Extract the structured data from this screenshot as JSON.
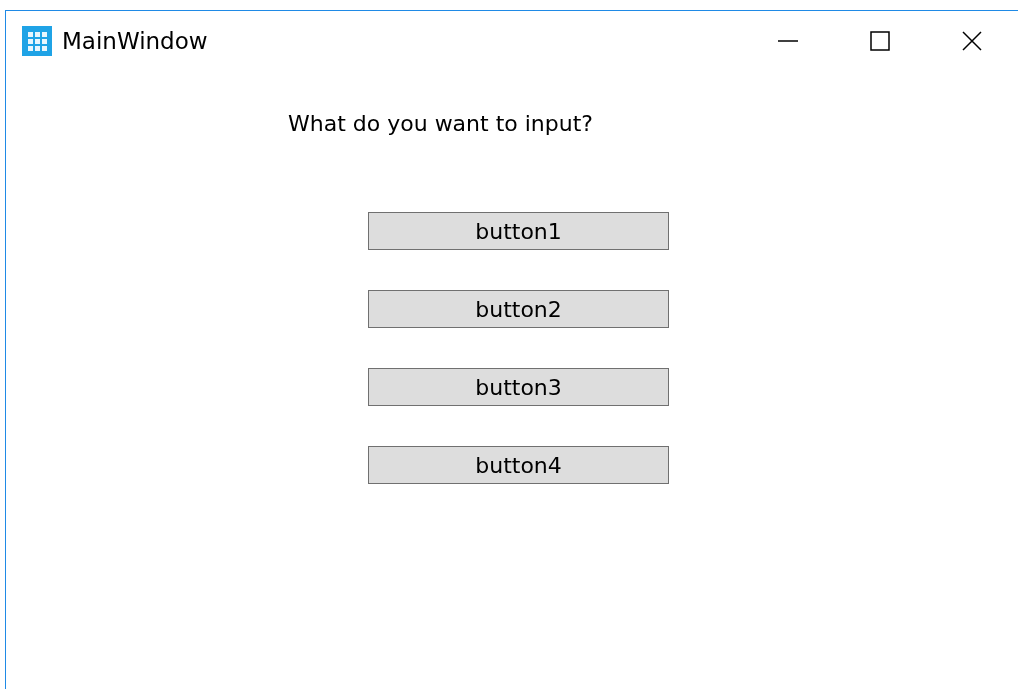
{
  "window": {
    "title": "MainWindow"
  },
  "prompt": "What do you want to input?",
  "buttons": [
    {
      "label": "button1"
    },
    {
      "label": "button2"
    },
    {
      "label": "button3"
    },
    {
      "label": "button4"
    }
  ]
}
